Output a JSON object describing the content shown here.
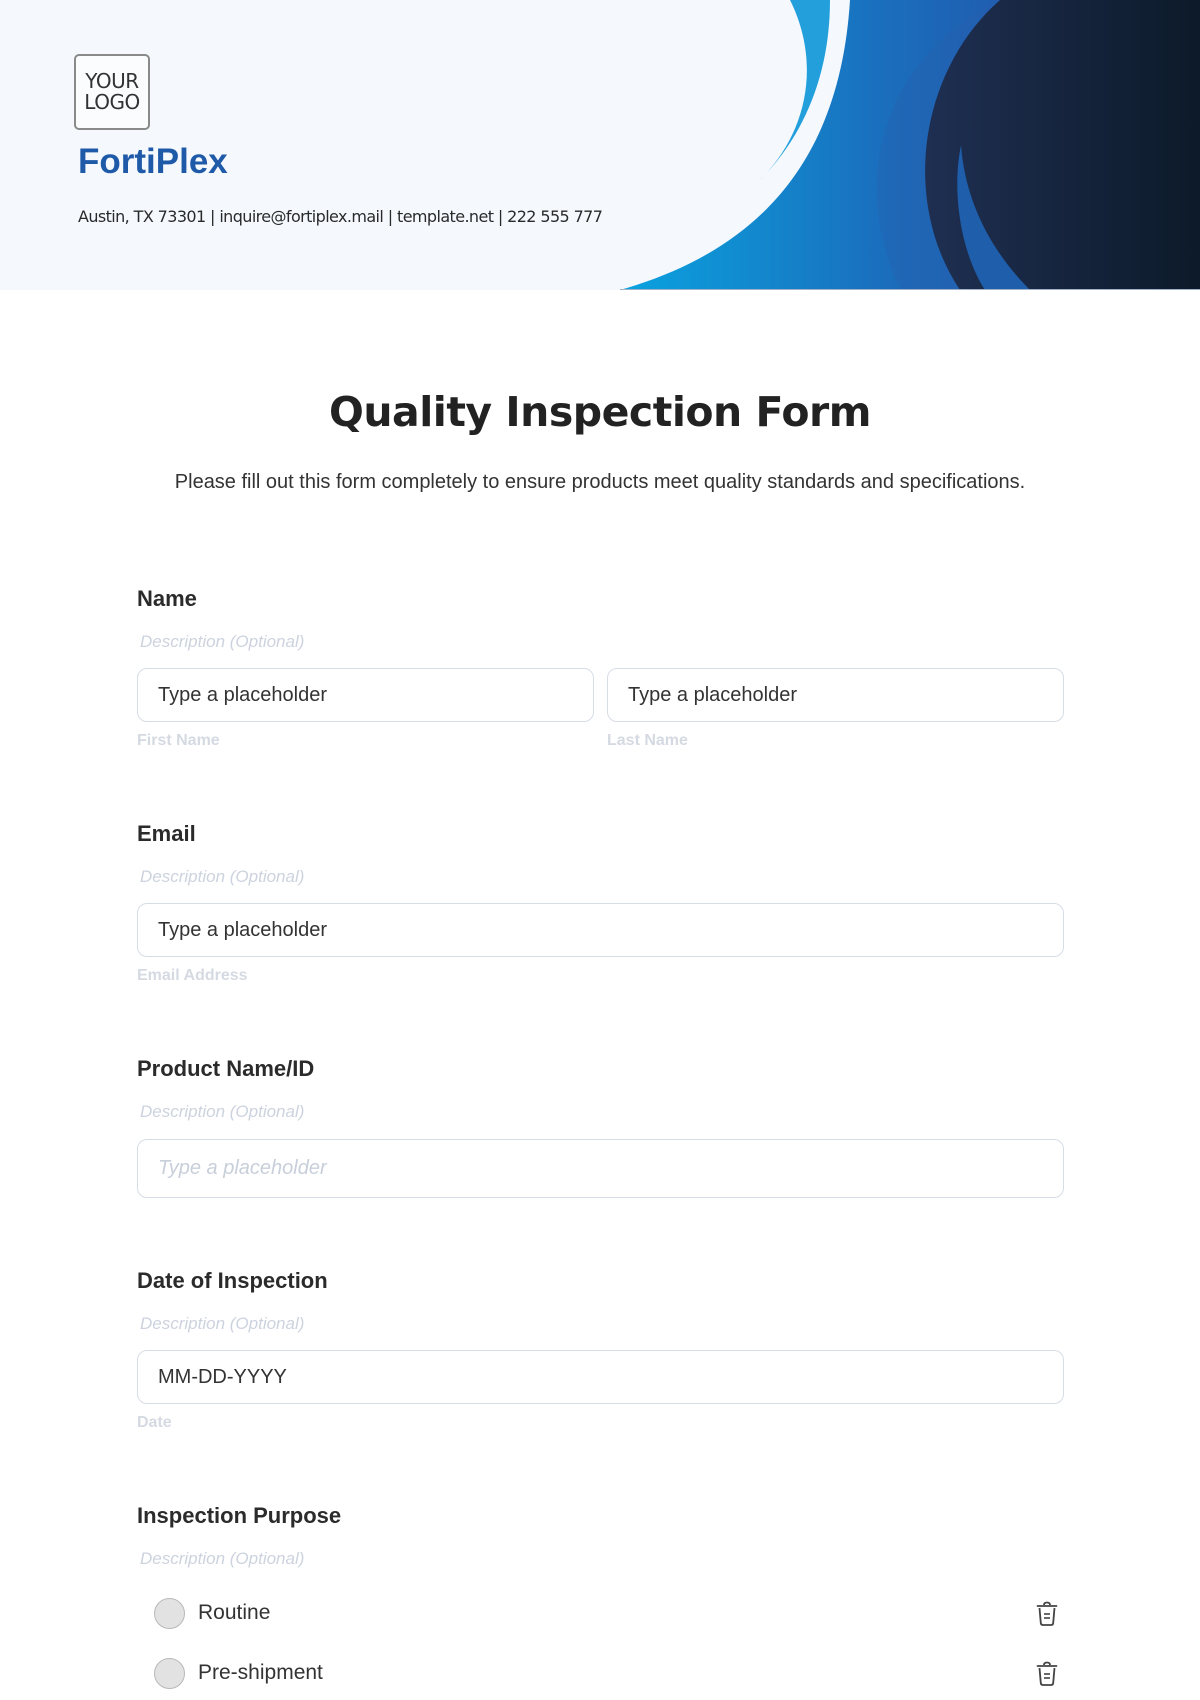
{
  "header": {
    "logo_line1": "YOUR",
    "logo_line2": "LOGO",
    "company": "FortiPlex",
    "contact": "Austin, TX 73301 | inquire@fortiplex.mail | template.net | 222 555 777",
    "colors": {
      "brand": "#1f5aa8",
      "wave_light": "#23a0dc",
      "wave_mid": "#1d5fb0",
      "wave_dark": "#13233d"
    }
  },
  "form": {
    "title": "Quality Inspection Form",
    "subtitle": "Please fill out this form completely to ensure products meet quality standards and specifications.",
    "fields": {
      "name": {
        "label": "Name",
        "description": "Description (Optional)",
        "first_value": "Type a placeholder",
        "first_sublabel": "First Name",
        "last_value": "Type a placeholder",
        "last_sublabel": "Last Name"
      },
      "email": {
        "label": "Email",
        "description": "Description (Optional)",
        "value": "Type a placeholder",
        "sublabel": "Email Address"
      },
      "product": {
        "label": "Product Name/ID",
        "description": "Description (Optional)",
        "placeholder": "Type a placeholder"
      },
      "date": {
        "label": "Date of Inspection",
        "description": "Description (Optional)",
        "value": "MM-DD-YYYY",
        "sublabel": "Date"
      },
      "purpose": {
        "label": "Inspection Purpose",
        "description": "Description (Optional)",
        "options": [
          {
            "label": "Routine",
            "selected": false,
            "icon": "trash-icon"
          },
          {
            "label": "Pre-shipment",
            "selected": false,
            "icon": "trash-icon"
          }
        ]
      }
    }
  }
}
